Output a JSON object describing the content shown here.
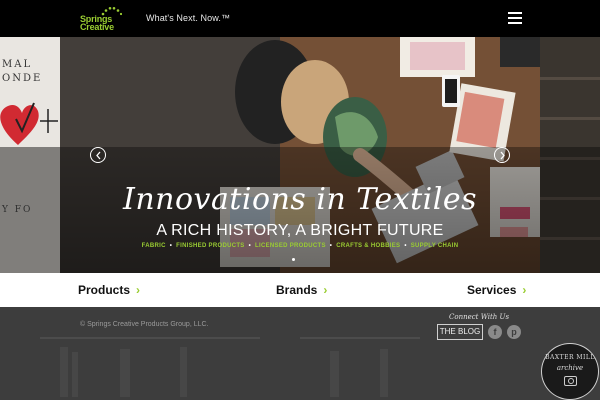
{
  "header": {
    "logo_line1": "Springs",
    "logo_line2": "Creative",
    "tagline": "What's Next. Now.™",
    "menu_icon": "hamburger-menu-icon"
  },
  "hero": {
    "left_panel_text": [
      "MAL",
      "ONDE",
      "Y FO"
    ],
    "headline": "Innovations in Textiles",
    "subhead": "A RICH HISTORY, A BRIGHT FUTURE",
    "tags": [
      "FABRIC",
      "FINISHED PRODUCTS",
      "LICENSED PRODUCTS",
      "CRAFTS & HOBBIES",
      "SUPPLY CHAIN"
    ],
    "prev_icon": "chevron-left-icon",
    "next_icon": "chevron-right-icon"
  },
  "nav": {
    "products": "Products",
    "brands": "Brands",
    "services": "Services",
    "chevron": "›"
  },
  "footer": {
    "copyright": "© Springs Creative Products Group, LLC.",
    "connect": "Connect With Us",
    "blog": "THE BLOG",
    "facebook": "f",
    "pinterest": "p"
  },
  "badge": {
    "line1": "BAXTER MILL",
    "line2": "archive"
  },
  "colors": {
    "accent": "#9acd32",
    "header_bg": "#000000",
    "nav_bg": "#ffffff",
    "footer_bg": "#3d3d3d"
  }
}
